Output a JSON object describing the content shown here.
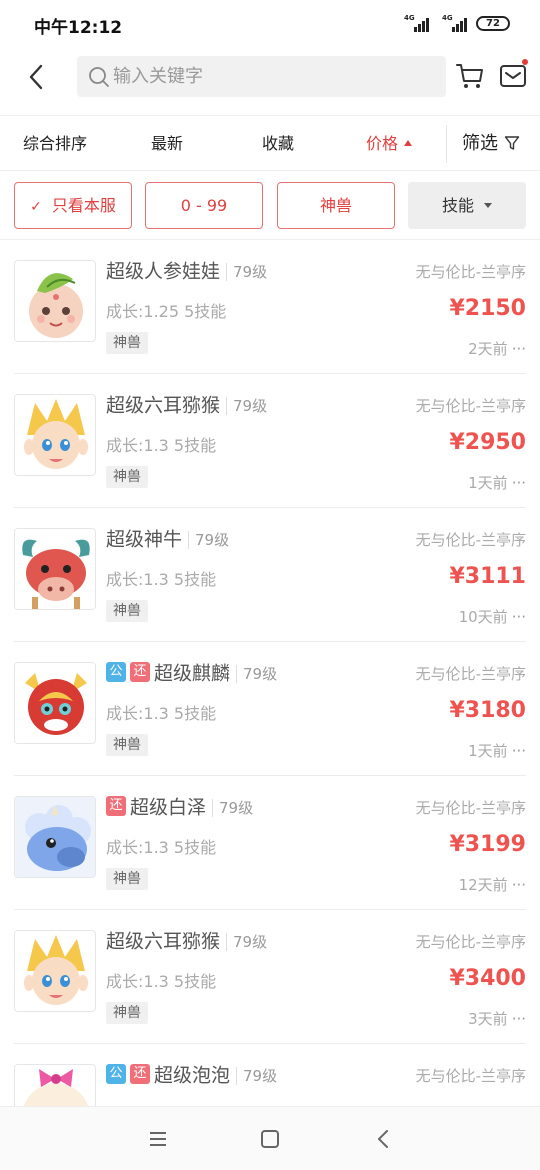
{
  "status_bar": {
    "time": "中午12:12",
    "signal1_tag": "4G",
    "signal2_tag": "4G",
    "battery": "72"
  },
  "search": {
    "placeholder": "输入关键字"
  },
  "icons": {
    "back": "back-chevron-icon",
    "search": "search-icon",
    "cart": "cart-icon",
    "mail": "mail-icon",
    "filter": "filter-funnel-icon",
    "menu": "menu-icon",
    "home": "home-square-icon",
    "nav_back": "nav-back-icon"
  },
  "colors": {
    "accent": "#e04040",
    "price": "#ef5350",
    "badge_gong": "#4fb3e8",
    "badge_huan": "#f06e78"
  },
  "sort_bar": {
    "items": [
      {
        "label": "综合排序"
      },
      {
        "label": "最新"
      },
      {
        "label": "收藏"
      },
      {
        "label": "价格"
      }
    ],
    "active": "价格",
    "filter_label": "筛选"
  },
  "filter_chips": {
    "own_server": "只看本服",
    "price_range": "0 - 99",
    "category": "神兽",
    "skills": "技能"
  },
  "items": [
    {
      "badges": [],
      "name": "超级人参娃娃",
      "level": "79级",
      "growth": "成长:1.25 5技能",
      "tag": "神兽",
      "server": "无与伦比-兰亭序",
      "price": "¥2150",
      "time": "2天前"
    },
    {
      "badges": [],
      "name": "超级六耳猕猴",
      "level": "79级",
      "growth": "成长:1.3 5技能",
      "tag": "神兽",
      "server": "无与伦比-兰亭序",
      "price": "¥2950",
      "time": "1天前"
    },
    {
      "badges": [],
      "name": "超级神牛",
      "level": "79级",
      "growth": "成长:1.3 5技能",
      "tag": "神兽",
      "server": "无与伦比-兰亭序",
      "price": "¥3111",
      "time": "10天前"
    },
    {
      "badges": [
        "公",
        "还"
      ],
      "name": "超级麒麟",
      "level": "79级",
      "growth": "成长:1.3 5技能",
      "tag": "神兽",
      "server": "无与伦比-兰亭序",
      "price": "¥3180",
      "time": "1天前"
    },
    {
      "badges": [
        "还"
      ],
      "name": "超级白泽",
      "level": "79级",
      "growth": "成长:1.3 5技能",
      "tag": "神兽",
      "server": "无与伦比-兰亭序",
      "price": "¥3199",
      "time": "12天前"
    },
    {
      "badges": [],
      "name": "超级六耳猕猴",
      "level": "79级",
      "growth": "成长:1.3 5技能",
      "tag": "神兽",
      "server": "无与伦比-兰亭序",
      "price": "¥3400",
      "time": "3天前"
    },
    {
      "badges": [
        "公",
        "还"
      ],
      "name": "超级泡泡",
      "level": "79级",
      "server": "无与伦比-兰亭序"
    }
  ],
  "more_glyph": "···"
}
